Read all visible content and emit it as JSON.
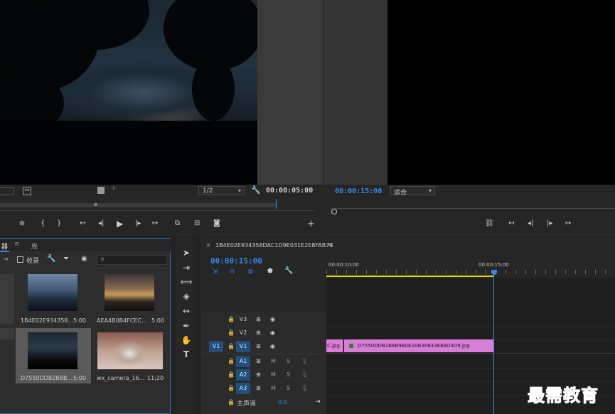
{
  "source_monitor": {
    "zoom": "1/2",
    "timecode": "00:00:05:00"
  },
  "program_monitor": {
    "timecode": "00:00:15:00",
    "fit": "适合"
  },
  "project": {
    "tab_label_partial": "器",
    "tab_library": "库",
    "favorites_label": "收录",
    "search_placeholder": "",
    "items": [
      {
        "name": "1B4E02E934358...",
        "duration": "5:00"
      },
      {
        "name": "AEA4B0B4FCEC...",
        "duration": "5:00"
      },
      {
        "name": "D7550DDB2B8B...",
        "duration": "5:00"
      },
      {
        "name": "wx_camera_16...",
        "duration": "11;20"
      }
    ]
  },
  "timeline": {
    "sequence_name": "1B4E02E934358DAC1D9E031E2E8FAB78",
    "timecode": "00:00:15:00",
    "ruler_marks": [
      "00:00:10:00",
      "00:00:15:00"
    ],
    "video_tracks": [
      "V3",
      "V2",
      "V1"
    ],
    "source_patch": "V1",
    "audio_tracks": [
      "A1",
      "A2",
      "A3"
    ],
    "mute_label": "M",
    "solo_label": "S",
    "master_label": "主声道",
    "master_value": "0.0",
    "clips": [
      {
        "label": "C.jpg"
      },
      {
        "label": "D7550DDB2B8B9B0E2AB3FB43688D3D9.jpg"
      }
    ]
  },
  "watermark": "最需教育",
  "colors": {
    "accent_blue": "#2d8ceb",
    "clip_pink": "#d87ed8",
    "work_area_yellow": "#e6d400",
    "focus_border": "#2d6fb5"
  }
}
